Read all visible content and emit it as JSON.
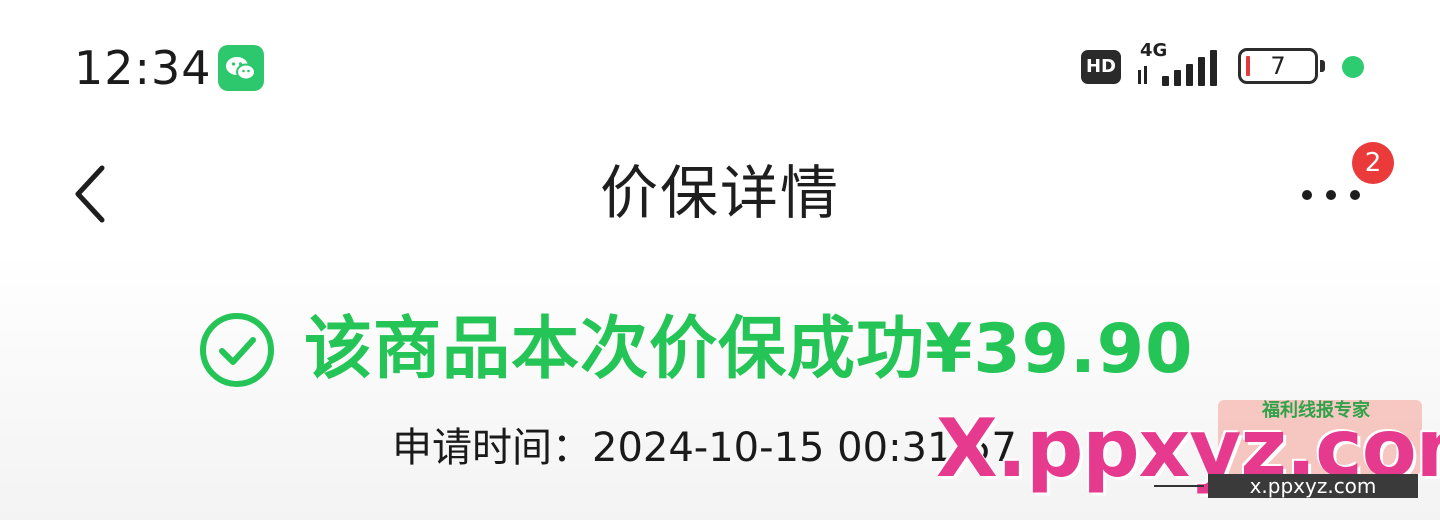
{
  "status_bar": {
    "time": "12:34",
    "app_icon": "wechat-icon",
    "hd_label": "HD",
    "network_label": "4G",
    "battery_level": "7",
    "battery_fraction": 0.07,
    "status_dot_color": "#2ecc71"
  },
  "nav": {
    "back_icon": "chevron-left-icon",
    "title": "价保详情",
    "more_icon": "more-horizontal-icon",
    "badge_count": "2"
  },
  "result": {
    "icon": "check-circle-icon",
    "message": "该商品本次价保成功¥39.90",
    "apply_time_label": "申请时间：",
    "apply_time_value": "2024-10-15 00:31:57",
    "accent_color": "#25c456"
  },
  "watermark": {
    "brand": "福利线报专家",
    "main": "X.ppxyz.com",
    "sub": "x.ppxyz.com"
  }
}
